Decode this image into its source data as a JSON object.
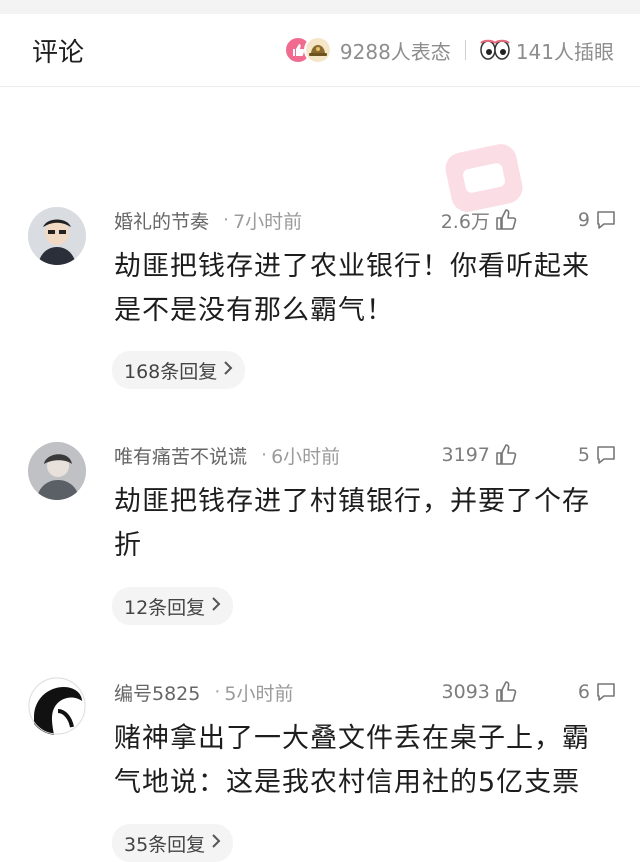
{
  "header": {
    "title": "评论",
    "reactions_text": "9288人表态",
    "lookers_text": "141人插眼",
    "reaction_icons": [
      "thumbs-up-icon",
      "helmet-icon",
      "eyes-icon"
    ],
    "accent": "#f06b8f"
  },
  "comments": [
    {
      "user": "婚礼的节奏",
      "time": "7小时前",
      "likes": "2.6万",
      "replies_count": "9",
      "content_line1": "劫匪把钱存进了农业银行！你看听起来",
      "content_line2": "是不是没有那么霸气！",
      "reply_label": "168条回复"
    },
    {
      "user": "唯有痛苦不说谎",
      "time": "6小时前",
      "likes": "3197",
      "replies_count": "5",
      "content_line1": "劫匪把钱存进了村镇银行，并要了个存",
      "content_line2": "折",
      "reply_label": "12条回复"
    },
    {
      "user": "编号5825",
      "time": "5小时前",
      "likes": "3093",
      "replies_count": "6",
      "content_line1": "赌神拿出了一大叠文件丢在桌子上，霸",
      "content_line2": "气地说：这是我农村信用社的5亿支票",
      "reply_label": "35条回复"
    }
  ]
}
